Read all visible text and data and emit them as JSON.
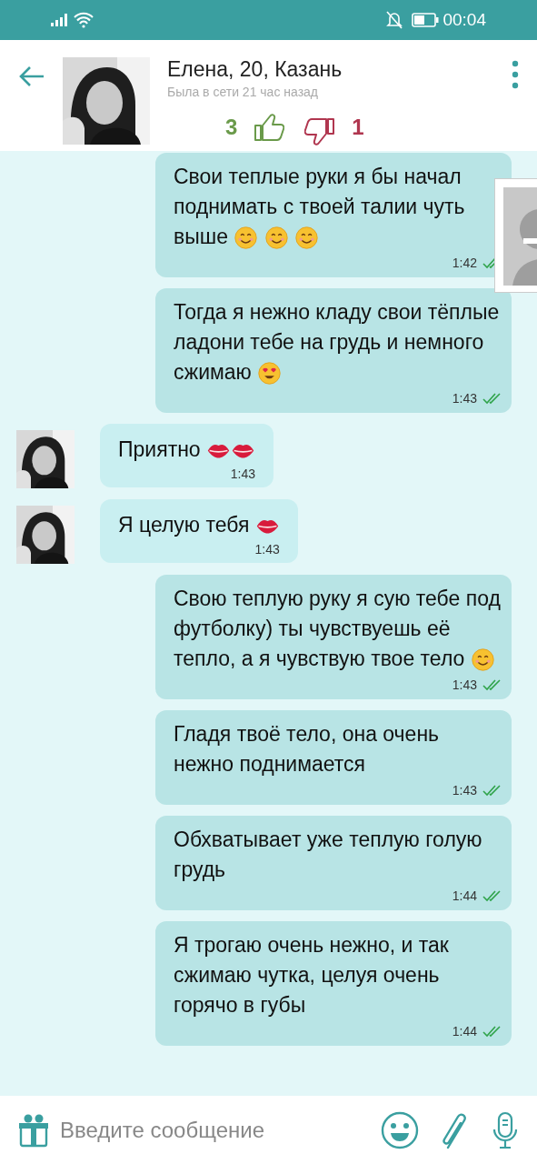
{
  "status_bar": {
    "time": "00:04"
  },
  "header": {
    "name": "Елена, 20, Казань",
    "last_seen": "Была в сети 21 час назад",
    "likes": "3",
    "dislikes": "1"
  },
  "messages": [
    {
      "kind": "outgoing",
      "text": "Свои теплые руки я бы начал поднимать с твоей талии чуть выше",
      "emoji": [
        {
          "kind": "smile"
        },
        {
          "kind": "smile"
        },
        {
          "kind": "smile"
        }
      ],
      "time": "1:42",
      "read": true
    },
    {
      "kind": "outgoing",
      "text": "Тогда я нежно кладу свои тёплые ладони тебе на грудь и немного сжимаю",
      "emoji": [
        {
          "kind": "hearteyes"
        }
      ],
      "time": "1:43",
      "read": true
    },
    {
      "kind": "incoming",
      "text": "Приятно",
      "emoji": [
        {
          "kind": "kiss"
        },
        {
          "kind": "kiss"
        }
      ],
      "time": "1:43"
    },
    {
      "kind": "incoming",
      "text": "Я целую тебя",
      "emoji": [
        {
          "kind": "kiss"
        }
      ],
      "time": "1:43"
    },
    {
      "kind": "outgoing",
      "text": "Свою теплую руку я сую тебе под футболку) ты чувствуешь её тепло, а я чувствую твое тело",
      "emoji": [
        {
          "kind": "smile"
        }
      ],
      "time": "1:43",
      "read": true
    },
    {
      "kind": "outgoing",
      "text": "Гладя твоё тело, она очень нежно поднимается",
      "time": "1:43",
      "read": true
    },
    {
      "kind": "outgoing",
      "text": "Обхватывает уже теплую голую грудь",
      "time": "1:44",
      "read": true
    },
    {
      "kind": "outgoing",
      "text": "Я трогаю очень нежно, и так сжимаю чутка, целуя очень горячо в губы",
      "time": "1:44",
      "read": true
    }
  ],
  "composer": {
    "placeholder": "Введите сообщение"
  }
}
